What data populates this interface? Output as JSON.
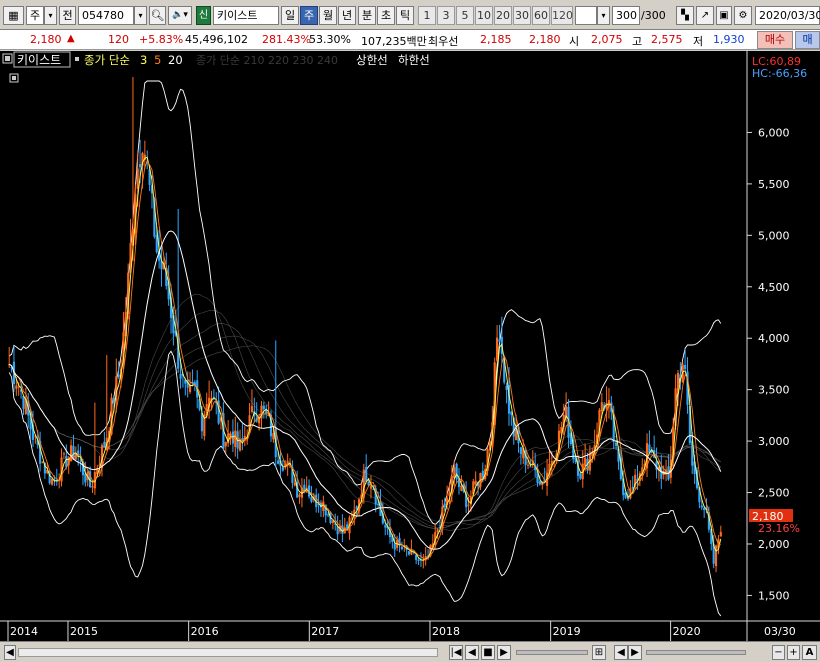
{
  "toolbar": {
    "market_label": "주",
    "market_dropdown": "▾",
    "prev_label": "전",
    "code_value": "054780",
    "credit_badge": "신",
    "stock_name": "키이스트",
    "period_day": "일",
    "period_week": "주",
    "period_month": "월",
    "period_year": "년",
    "period_min": "분",
    "period_tick": "초",
    "period_tic": "틱",
    "intervals": [
      "1",
      "3",
      "5",
      "10",
      "20",
      "30",
      "60",
      "120"
    ],
    "count_value": "300",
    "count_total": "/300",
    "date_value": "2020/03/30"
  },
  "quote": {
    "price": "2,180",
    "arrow": "▲",
    "change": "120",
    "change_pct": "+5.83%",
    "volume": "45,496,102",
    "volume_ratio": "281.43%",
    "turnover": "53.30%",
    "amount": "107,235백만",
    "best_label": "최우선",
    "best_ask": "2,185",
    "best_bid": "2,180",
    "open_label": "시",
    "open": "2,075",
    "high_label": "고",
    "high": "2,575",
    "low_label": "저",
    "low": "1,930",
    "buy_button": "매수",
    "sell_button": "매"
  },
  "legend": {
    "stock": "키이스트",
    "ma_label": "종가 단순",
    "ma_periods": [
      "3",
      "5",
      "20"
    ],
    "env_label": "종가 단순 210 220 230 240",
    "upper": "상한선",
    "lower": "하한선",
    "lc": "LC:60,89",
    "hc": "HC:-66,36"
  },
  "chart_data": {
    "type": "candlestick",
    "y_axis_ticks": [
      "6,000",
      "5,500",
      "5,000",
      "4,500",
      "4,000",
      "3,500",
      "3,000",
      "2,500",
      "2,000",
      "1,500"
    ],
    "ylim": [
      1300,
      6500
    ],
    "x_axis_labels": [
      "2014",
      "2015",
      "2016",
      "2017",
      "2018",
      "2019",
      "2020",
      "03/30"
    ],
    "current_price_label": "2,180",
    "current_pct_label": "23.16%",
    "colors": {
      "up": "#ff6a1a",
      "down": "#2ea8ff",
      "ma3": "#ffff60",
      "ma5": "#ffffff",
      "ma20": "#ffffff",
      "band": "#ffffff",
      "axis_text": "#ffffff",
      "lc": "#ff3030",
      "hc": "#4aa0ff"
    },
    "close_series_approx": [
      3750,
      3600,
      3400,
      3100,
      2900,
      2700,
      2600,
      2750,
      2850,
      2900,
      2700,
      2550,
      2800,
      3000,
      3400,
      3700,
      4500,
      5500,
      6000,
      5400,
      4800,
      4600,
      4200,
      3700,
      3400,
      3500,
      3200,
      3500,
      3300,
      3000,
      3100,
      2900,
      3100,
      3300,
      3300,
      3200,
      2900,
      2800,
      2700,
      2500,
      2600,
      2400,
      2450,
      2300,
      2200,
      2100,
      2200,
      2400,
      2700,
      2600,
      2300,
      2100,
      2000,
      1950,
      1900,
      1850,
      1800,
      1950,
      2200,
      2400,
      2700,
      2500,
      2400,
      2600,
      2700,
      3100,
      4200,
      3500,
      3100,
      2900,
      2800,
      2700,
      2600,
      2800,
      3000,
      3300,
      2900,
      2700,
      2800,
      3000,
      3400,
      3300,
      2800,
      2500,
      2500,
      2700,
      2900,
      2800,
      2700,
      2600,
      3600,
      3800,
      2800,
      2500,
      2300,
      1800,
      2180
    ]
  },
  "bottom": {
    "zoom_out": "−",
    "zoom_in": "+",
    "auto_label": "A"
  }
}
